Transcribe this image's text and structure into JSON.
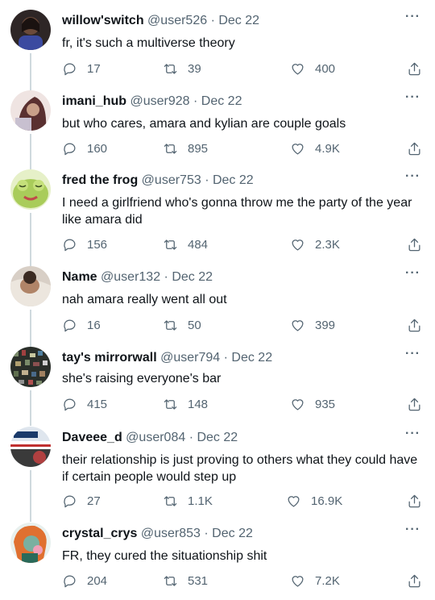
{
  "tweets": [
    {
      "name": "willow'switch",
      "handle": "@user526",
      "date": "Dec 22",
      "text": "fr, it's such a multiverse theory",
      "replies": "17",
      "retweets": "39",
      "likes": "400",
      "more": "···",
      "avatar_color": "#3a2a2a"
    },
    {
      "name": "imani_hub",
      "handle": "@user928",
      "date": "Dec 22",
      "text": "but who cares, amara and kylian are couple goals",
      "replies": "160",
      "retweets": "895",
      "likes": "4.9K",
      "more": "···",
      "avatar_color": "#8a5a5a"
    },
    {
      "name": "fred the frog",
      "handle": "@user753",
      "date": "Dec 22",
      "text": "I need a girlfriend who's gonna throw me the party of the year like amara did",
      "replies": "156",
      "retweets": "484",
      "likes": "2.3K",
      "more": "···",
      "avatar_color": "#b5d66a"
    },
    {
      "name": "Name",
      "handle": "@user132",
      "date": "Dec 22",
      "text": "nah amara really went all out",
      "replies": "16",
      "retweets": "50",
      "likes": "399",
      "more": "···",
      "avatar_color": "#c8b8a8"
    },
    {
      "name": "tay's mirrorwall",
      "handle": "@user794",
      "date": "Dec 22",
      "text": "she's raising everyone's bar",
      "replies": "415",
      "retweets": "148",
      "likes": "935",
      "more": "···",
      "avatar_color": "#4a5a4a"
    },
    {
      "name": "Daveee_d",
      "handle": "@user084",
      "date": "Dec 22",
      "text": "their relationship is just proving to others what they could have if certain people would step up",
      "replies": "27",
      "retweets": "1.1K",
      "likes": "16.9K",
      "more": "···",
      "avatar_color": "#9ab0c8"
    },
    {
      "name": "crystal_crys",
      "handle": "@user853",
      "date": "Dec 22",
      "text": "FR, they cured the situationship shit",
      "replies": "204",
      "retweets": "531",
      "likes": "7.2K",
      "more": "···",
      "avatar_color": "#3a8a7a"
    }
  ],
  "separator": "·"
}
